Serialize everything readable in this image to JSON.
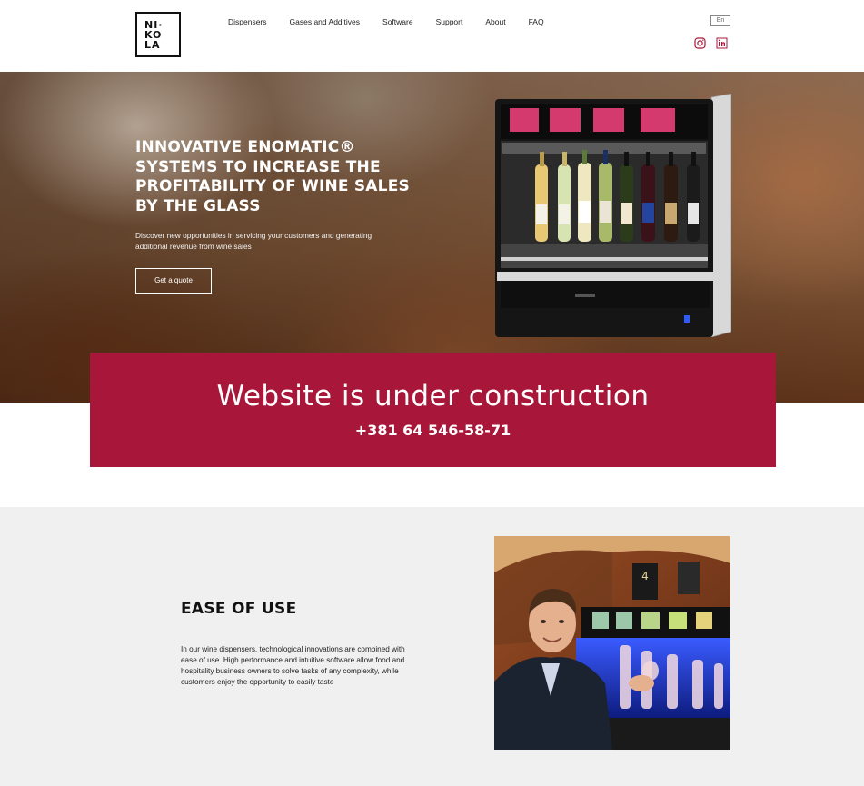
{
  "header": {
    "logo_lines": [
      "NI·",
      "KO",
      "LA"
    ],
    "nav": [
      "Dispensers",
      "Gases and Additives",
      "Software",
      "Support",
      "About",
      "FAQ"
    ],
    "language": "En",
    "social": [
      "instagram-icon",
      "linkedin-icon"
    ],
    "accent_color": "#a8173a"
  },
  "hero": {
    "title": "INNOVATIVE ENOMATIC® SYSTEMS TO INCREASE THE PROFITABILITY OF WINE SALES BY THE GLASS",
    "subtitle": "Discover new opportunities in servicing your customers and generating additional revenue from wine sales",
    "cta": "Get a quote"
  },
  "banner": {
    "title": "Website is under construction",
    "phone": "+381 64 546-58-71",
    "color": "#a8173a"
  },
  "ease": {
    "title": "EASE OF USE",
    "text": "In our wine dispensers, technological innovations are combined with ease of use. High performance and intuitive software allow food and hospitality business owners to solve tasks of any complexity, while customers enjoy the opportunity to easily taste",
    "photo_sign": "4"
  }
}
